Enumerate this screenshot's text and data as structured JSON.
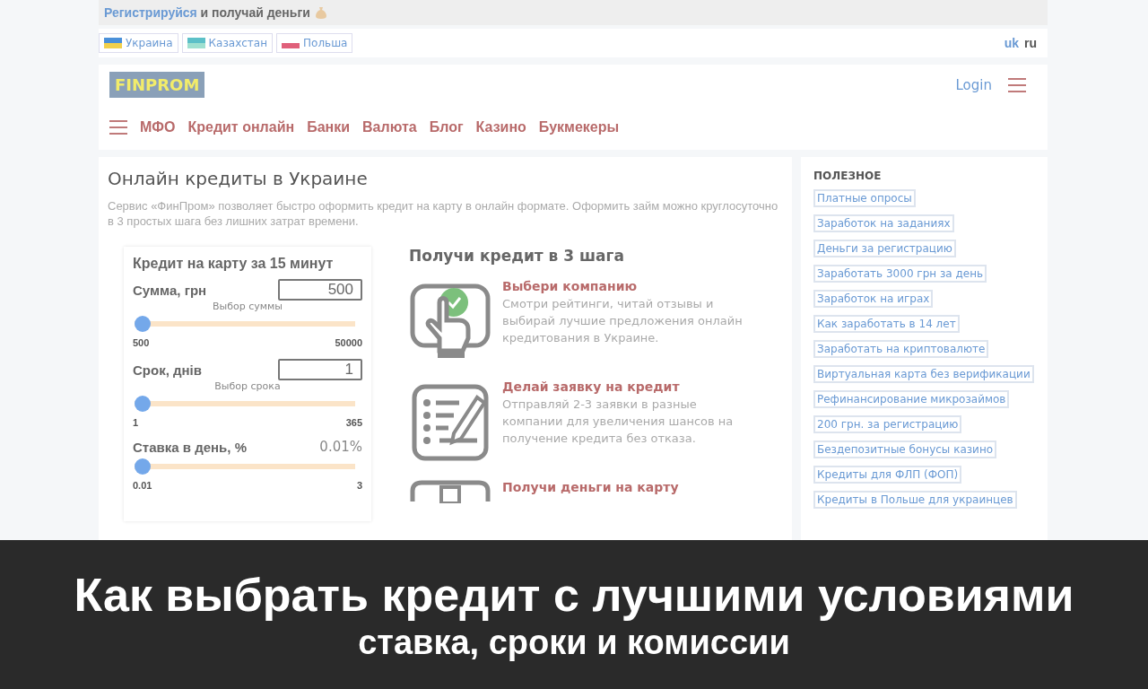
{
  "promo": {
    "link": "Регистрируйся",
    "text": "и получай деньги"
  },
  "countries": [
    {
      "label": "Украина",
      "kind": "ua"
    },
    {
      "label": "Казахстан",
      "kind": "kz"
    },
    {
      "label": "Польша",
      "kind": "pl"
    }
  ],
  "languages": [
    {
      "label": "uk",
      "selected": false
    },
    {
      "label": "ru",
      "selected": true
    }
  ],
  "header": {
    "logo": "FINPROM",
    "login": "Login"
  },
  "nav": [
    "МФО",
    "Кредит онлайн",
    "Банки",
    "Валюта",
    "Блог",
    "Казино",
    "Букмекеры"
  ],
  "main": {
    "title": "Онлайн кредиты в Украине",
    "intro": "Сервис «ФинПром» позволяет быстро оформить кредит на карту в онлайн формате. Оформить займ можно круглосуточно в 3 простых шага без лишних затрат времени."
  },
  "calculator": {
    "title": "Кредит на карту за 15 минут",
    "rows": [
      {
        "kind": "input",
        "label": "Сумма, грн",
        "value": "500",
        "hint": "Выбор суммы",
        "level": 0,
        "min": "500",
        "max": "50000"
      },
      {
        "kind": "input",
        "label": "Срок, днів",
        "value": "1",
        "hint": "Выбор срока",
        "level": 0,
        "min": "1",
        "max": "365"
      },
      {
        "kind": "readout",
        "label": "Ставка в день, %",
        "value": "0.01%",
        "level": 0,
        "min": "0.01",
        "max": "3"
      }
    ]
  },
  "steps": {
    "title": "Получи кредит в 3 шага",
    "items": [
      {
        "kind": "choose",
        "title": "Выбери компанию",
        "text": "Смотри рейтинги, читай отзывы и выбирай лучшие предложения онлайн кредитования в Украине."
      },
      {
        "kind": "apply",
        "title": "Делай заявку на кредит",
        "text": "Отправляй 2-3 заявки в разные компании для увеличения шансов на получение кредита без отказа."
      },
      {
        "kind": "money",
        "title": "Получи деньги на карту"
      }
    ]
  },
  "sidebar": {
    "title": "ПОЛЕЗНОЕ",
    "links": [
      "Платные опросы",
      "Заработок на заданиях",
      "Деньги за регистрацию",
      "Заработать 3000 грн за день",
      "Заработок на играх",
      "Как заработать в 14 лет",
      "Заработать на криптовалюте",
      "Виртуальная карта без верификации",
      "Рефинансирование микрозаймов",
      "200 грн. за регистрацию",
      "Бездепозитные бонусы казино",
      "Кредиты для ФЛП (ФОП)",
      "Кредиты в Польше для украинцев"
    ]
  },
  "banner": {
    "title": "Как выбрать кредит с лучшими условиями",
    "subtitle": "ставка, сроки и комиссии"
  }
}
